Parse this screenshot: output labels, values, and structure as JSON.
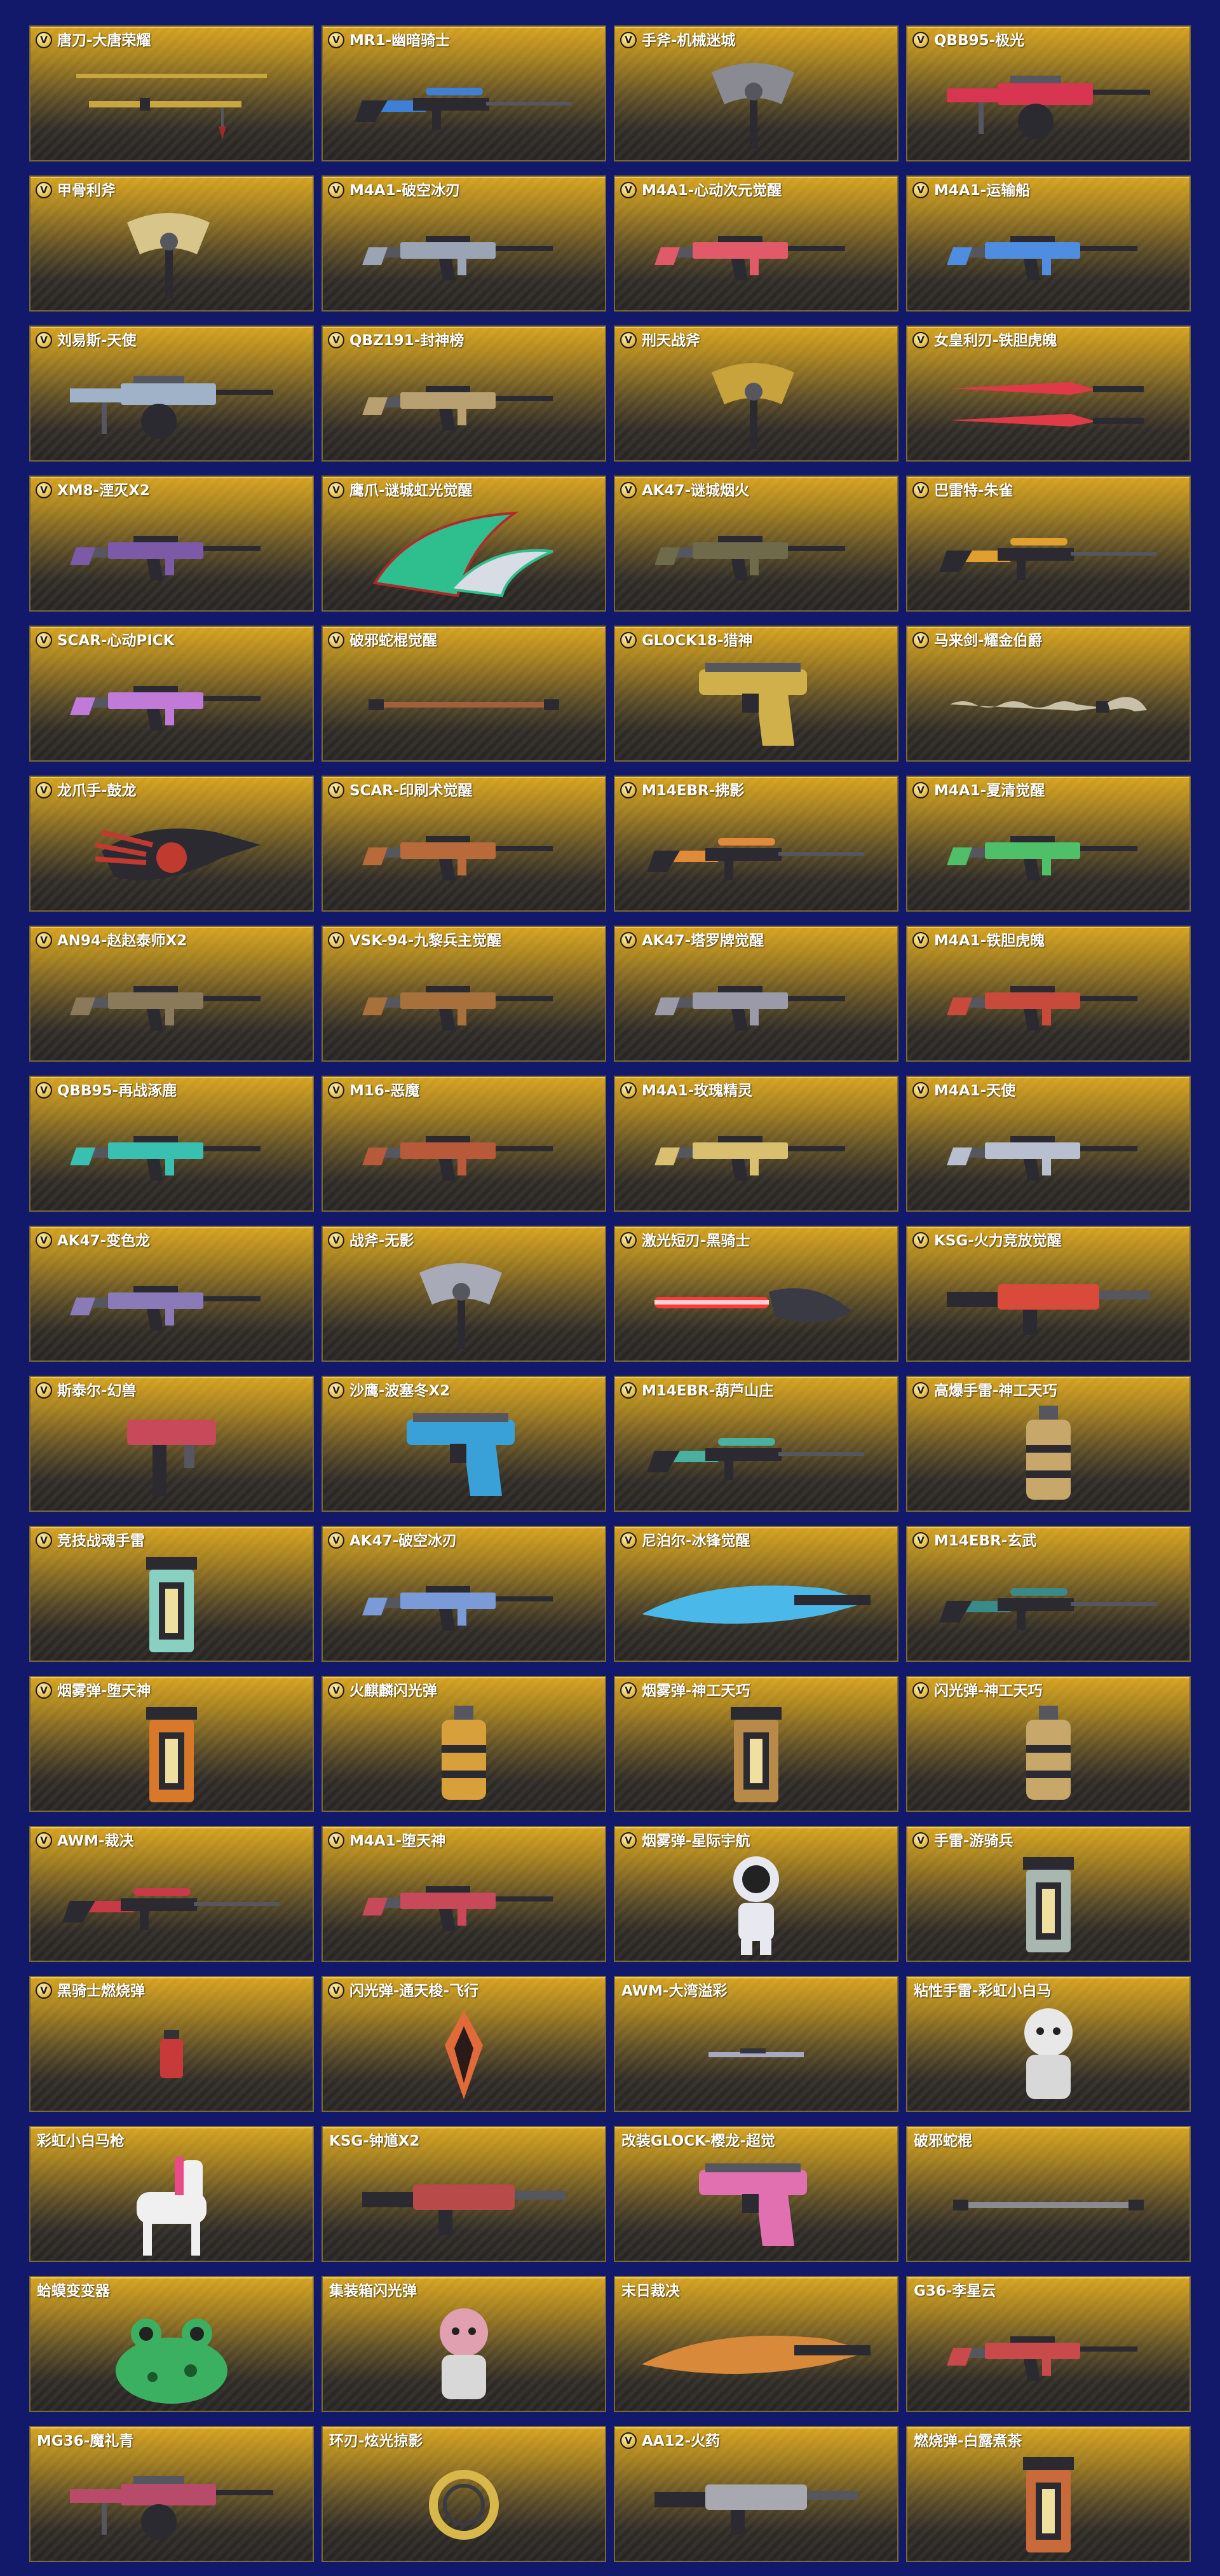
{
  "badge_letter": "V",
  "items": [
    {
      "name": "唐刀-大唐荣耀",
      "type": "blade",
      "color": "#c8a640",
      "badge": true
    },
    {
      "name": "MR1-幽暗骑士",
      "type": "sniper",
      "color": "#3f7fd6",
      "badge": true
    },
    {
      "name": "手斧-机械迷城",
      "type": "axe",
      "color": "#8a8a92",
      "badge": true
    },
    {
      "name": "QBB95-极光",
      "type": "lmg",
      "color": "#d83550",
      "badge": true
    },
    {
      "name": "甲骨利斧",
      "type": "axe",
      "color": "#d8c58a",
      "badge": true
    },
    {
      "name": "M4A1-破空冰刃",
      "type": "rifle",
      "color": "#9aa4b4",
      "badge": true
    },
    {
      "name": "M4A1-心动次元觉醒",
      "type": "rifle",
      "color": "#e05a6a",
      "badge": true
    },
    {
      "name": "M4A1-运输船",
      "type": "rifle",
      "color": "#4f8de0",
      "badge": true
    },
    {
      "name": "刘易斯-天使",
      "type": "lmg",
      "color": "#a0b2c8",
      "badge": true
    },
    {
      "name": "QBZ191-封神榜",
      "type": "rifle",
      "color": "#b8a070",
      "badge": true
    },
    {
      "name": "刑天战斧",
      "type": "axe",
      "color": "#c8a23a",
      "badge": true
    },
    {
      "name": "女皇利刃-铁胆虎魄",
      "type": "dualblade",
      "color": "#e03a48",
      "badge": true
    },
    {
      "name": "XM8-湮灭X2",
      "type": "rifle",
      "color": "#7c5aa8",
      "badge": true
    },
    {
      "name": "鹰爪-谜城虹光觉醒",
      "type": "karambit",
      "color": "#2fbf8f",
      "badge": true
    },
    {
      "name": "AK47-谜城烟火",
      "type": "rifle",
      "color": "#6f6a4a",
      "badge": true
    },
    {
      "name": "巴雷特-朱雀",
      "type": "sniper",
      "color": "#e0a030",
      "badge": true
    },
    {
      "name": "SCAR-心动PICK",
      "type": "rifle",
      "color": "#c07ad8",
      "badge": true
    },
    {
      "name": "破邪蛇棍觉醒",
      "type": "staff",
      "color": "#a0603a",
      "badge": true
    },
    {
      "name": "GLOCK18-猎神",
      "type": "pistol",
      "color": "#d0b04a",
      "badge": true
    },
    {
      "name": "马来剑-耀金伯爵",
      "type": "kris",
      "color": "#c8c0a8",
      "badge": true
    },
    {
      "name": "龙爪手-鼓龙",
      "type": "claw",
      "color": "#c03a30",
      "badge": true
    },
    {
      "name": "SCAR-印刷术觉醒",
      "type": "rifle",
      "color": "#b86a3a",
      "badge": true
    },
    {
      "name": "M14EBR-拂影",
      "type": "sniper",
      "color": "#e08a3a",
      "badge": true
    },
    {
      "name": "M4A1-夏清觉醒",
      "type": "rifle",
      "color": "#4fbf6a",
      "badge": true
    },
    {
      "name": "AN94-赵赵泰师X2",
      "type": "rifle",
      "color": "#8a7a5a",
      "badge": true
    },
    {
      "name": "VSK-94-九黎兵主觉醒",
      "type": "rifle",
      "color": "#a8703a",
      "badge": true
    },
    {
      "name": "AK47-塔罗牌觉醒",
      "type": "rifle",
      "color": "#9a9aa8",
      "badge": true
    },
    {
      "name": "M4A1-铁胆虎魄",
      "type": "rifle",
      "color": "#c84a3a",
      "badge": true
    },
    {
      "name": "QBB95-再战涿鹿",
      "type": "rifle",
      "color": "#3ac0b0",
      "badge": true
    },
    {
      "name": "M16-恶魔",
      "type": "rifle",
      "color": "#b85a3a",
      "badge": true
    },
    {
      "name": "M4A1-玫瑰精灵",
      "type": "rifle",
      "color": "#d8c070",
      "badge": true
    },
    {
      "name": "M4A1-天使",
      "type": "rifle",
      "color": "#b8c0d0",
      "badge": true
    },
    {
      "name": "AK47-变色龙",
      "type": "rifle",
      "color": "#8a7ab8",
      "badge": true
    },
    {
      "name": "战斧-无影",
      "type": "axe",
      "color": "#a8aab8",
      "badge": true
    },
    {
      "name": "激光短刃-黑骑士",
      "type": "laser",
      "color": "#ff3a3a",
      "badge": true
    },
    {
      "name": "KSG-火力竞放觉醒",
      "type": "shotgun",
      "color": "#d84a3a",
      "badge": true
    },
    {
      "name": "斯泰尔-幻兽",
      "type": "smg",
      "color": "#c84a5a",
      "badge": true
    },
    {
      "name": "沙鹰-波塞冬X2",
      "type": "pistol",
      "color": "#3aa0d8",
      "badge": true
    },
    {
      "name": "M14EBR-葫芦山庄",
      "type": "sniper",
      "color": "#4ab0a0",
      "badge": true
    },
    {
      "name": "高爆手雷-神工天巧",
      "type": "grenade",
      "color": "#c8a86a",
      "badge": true
    },
    {
      "name": "竞技战魂手雷",
      "type": "canister",
      "color": "#8ad0c0",
      "badge": true
    },
    {
      "name": "AK47-破空冰刃",
      "type": "rifle",
      "color": "#7a9ad8",
      "badge": true
    },
    {
      "name": "尼泊尔-冰锋觉醒",
      "type": "bigblade",
      "color": "#4ab8e8",
      "badge": true
    },
    {
      "name": "M14EBR-玄武",
      "type": "sniper",
      "color": "#3a8a8a",
      "badge": true
    },
    {
      "name": "烟雾弹-堕天神",
      "type": "canister",
      "color": "#d8782a",
      "badge": true
    },
    {
      "name": "火麒麟闪光弹",
      "type": "grenade",
      "color": "#d8a03a",
      "badge": true
    },
    {
      "name": "烟雾弹-神工天巧",
      "type": "canister",
      "color": "#b88a4a",
      "badge": true
    },
    {
      "name": "闪光弹-神工天巧",
      "type": "grenade",
      "color": "#c8a86a",
      "badge": true
    },
    {
      "name": "AWM-裁决",
      "type": "sniper",
      "color": "#c83a48",
      "badge": true
    },
    {
      "name": "M4A1-堕天神",
      "type": "rifle",
      "color": "#c84a5a",
      "badge": true
    },
    {
      "name": "烟雾弹-星际宇航",
      "type": "astronaut",
      "color": "#e8e8f0",
      "badge": true
    },
    {
      "name": "手雷-游骑兵",
      "type": "canister",
      "color": "#a8b8b0",
      "badge": true
    },
    {
      "name": "黑骑士燃烧弹",
      "type": "smallcan",
      "color": "#c83a3a",
      "badge": true
    },
    {
      "name": "闪光弹-通天梭-飞行",
      "type": "crystal",
      "color": "#e06a3a",
      "badge": true
    },
    {
      "name": "AWM-大湾溢彩",
      "type": "smallgun",
      "color": "#a8a8c0",
      "badge": false
    },
    {
      "name": "粘性手雷-彩虹小白马",
      "type": "figure",
      "color": "#e8e8e8",
      "badge": false
    },
    {
      "name": "彩虹小白马枪",
      "type": "horse",
      "color": "#f0f0f0",
      "badge": false
    },
    {
      "name": "KSG-钟馗X2",
      "type": "shotgun",
      "color": "#b84a4a",
      "badge": false
    },
    {
      "name": "改装GLOCK-樱龙-超觉",
      "type": "pistol",
      "color": "#e070b0",
      "badge": false
    },
    {
      "name": "破邪蛇棍",
      "type": "staff",
      "color": "#8a8a90",
      "badge": false
    },
    {
      "name": "蛤蟆变变器",
      "type": "frog",
      "color": "#3ab060",
      "badge": false
    },
    {
      "name": "集装箱闪光弹",
      "type": "figure",
      "color": "#e0a0b0",
      "badge": false
    },
    {
      "name": "末日裁决",
      "type": "bigblade",
      "color": "#d88a3a",
      "badge": false
    },
    {
      "name": "G36-李星云",
      "type": "rifle",
      "color": "#c84a4a",
      "badge": false
    },
    {
      "name": "MG36-魔礼青",
      "type": "lmg",
      "color": "#b84a6a",
      "badge": false
    },
    {
      "name": "环刃-炫光掠影",
      "type": "ring",
      "color": "#d8b84a",
      "badge": false
    },
    {
      "name": "AA12-火药",
      "type": "shotgun",
      "color": "#a8a8b0",
      "badge": true
    },
    {
      "name": "燃烧弹-白露煮茶",
      "type": "canister",
      "color": "#c86a3a",
      "badge": false
    }
  ]
}
